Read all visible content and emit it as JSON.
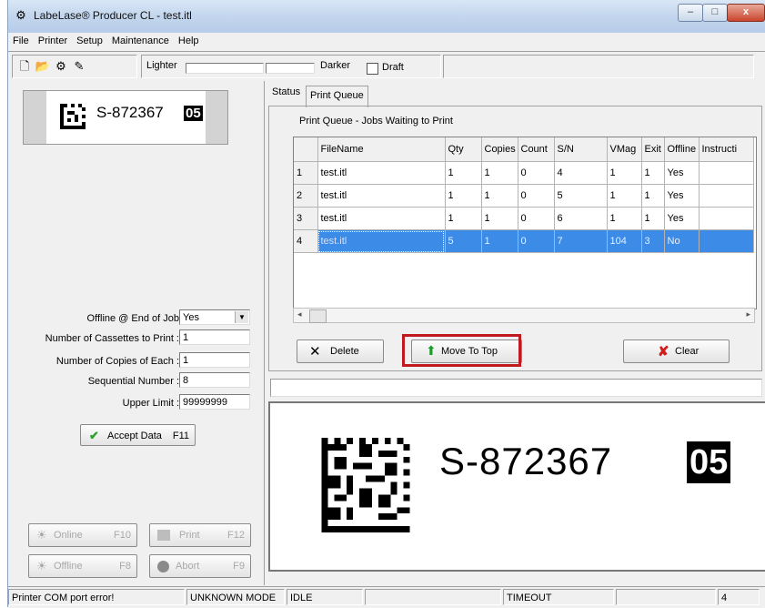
{
  "window": {
    "title": "LabeLase® Producer CL - test.itl",
    "minimize": "–",
    "maximize": "□",
    "close": "x"
  },
  "menu": [
    "File",
    "Printer",
    "Setup",
    "Maintenance",
    "Help"
  ],
  "toolbar": {
    "lighter_label": "Lighter",
    "darker_label": "Darker",
    "draft_label": "Draft"
  },
  "label": {
    "serial": "S-872367",
    "code": "05"
  },
  "form": {
    "offline_end_label": "Offline @ End of Job",
    "offline_end_value": "Yes",
    "cassettes_label": "Number of Cassettes to Print :",
    "cassettes_value": "1",
    "copies_label": "Number of Copies of Each :",
    "copies_value": "1",
    "sequential_label": "Sequential Number :",
    "sequential_value": "8",
    "upper_label": "Upper Limit :",
    "upper_value": "99999999",
    "accept_label": "Accept Data",
    "accept_key": "F11"
  },
  "controls": {
    "online_label": "Online",
    "online_key": "F10",
    "print_label": "Print",
    "print_key": "F12",
    "offline_label": "Offline",
    "offline_key": "F8",
    "abort_label": "Abort",
    "abort_key": "F9"
  },
  "tabs": [
    "Status",
    "Print Queue"
  ],
  "queue": {
    "heading": "Print Queue - Jobs Waiting to Print",
    "columns": [
      "FileName",
      "Qty",
      "Copies",
      "Count",
      "S/N",
      "VMag",
      "Exit",
      "Offline",
      "Instructi"
    ],
    "rows": [
      {
        "num": "1",
        "cells": [
          "test.itl",
          "1",
          "1",
          "0",
          "4",
          "1",
          "1",
          "Yes",
          ""
        ]
      },
      {
        "num": "2",
        "cells": [
          "test.itl",
          "1",
          "1",
          "0",
          "5",
          "1",
          "1",
          "Yes",
          ""
        ]
      },
      {
        "num": "3",
        "cells": [
          "test.itl",
          "1",
          "1",
          "0",
          "6",
          "1",
          "1",
          "Yes",
          ""
        ]
      },
      {
        "num": "4",
        "cells": [
          "test.itl",
          "5",
          "1",
          "0",
          "7",
          "104",
          "3",
          "No",
          ""
        ]
      }
    ],
    "delete_label": "Delete",
    "move_top_label": "Move To Top",
    "clear_label": "Clear"
  },
  "status": {
    "message": "Printer COM port error!",
    "mode": "UNKNOWN MODE",
    "state": "IDLE",
    "timeout": "TIMEOUT",
    "count": "4"
  }
}
